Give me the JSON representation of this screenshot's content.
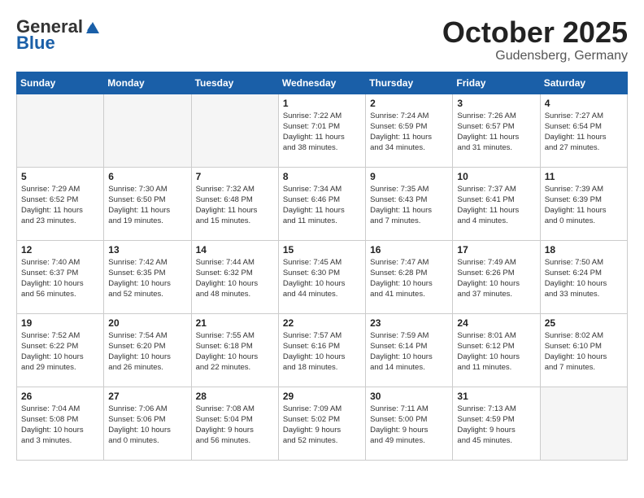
{
  "logo": {
    "general": "General",
    "blue": "Blue"
  },
  "title": "October 2025",
  "location": "Gudensberg, Germany",
  "days_of_week": [
    "Sunday",
    "Monday",
    "Tuesday",
    "Wednesday",
    "Thursday",
    "Friday",
    "Saturday"
  ],
  "weeks": [
    [
      {
        "num": "",
        "info": ""
      },
      {
        "num": "",
        "info": ""
      },
      {
        "num": "",
        "info": ""
      },
      {
        "num": "1",
        "info": "Sunrise: 7:22 AM\nSunset: 7:01 PM\nDaylight: 11 hours\nand 38 minutes."
      },
      {
        "num": "2",
        "info": "Sunrise: 7:24 AM\nSunset: 6:59 PM\nDaylight: 11 hours\nand 34 minutes."
      },
      {
        "num": "3",
        "info": "Sunrise: 7:26 AM\nSunset: 6:57 PM\nDaylight: 11 hours\nand 31 minutes."
      },
      {
        "num": "4",
        "info": "Sunrise: 7:27 AM\nSunset: 6:54 PM\nDaylight: 11 hours\nand 27 minutes."
      }
    ],
    [
      {
        "num": "5",
        "info": "Sunrise: 7:29 AM\nSunset: 6:52 PM\nDaylight: 11 hours\nand 23 minutes."
      },
      {
        "num": "6",
        "info": "Sunrise: 7:30 AM\nSunset: 6:50 PM\nDaylight: 11 hours\nand 19 minutes."
      },
      {
        "num": "7",
        "info": "Sunrise: 7:32 AM\nSunset: 6:48 PM\nDaylight: 11 hours\nand 15 minutes."
      },
      {
        "num": "8",
        "info": "Sunrise: 7:34 AM\nSunset: 6:46 PM\nDaylight: 11 hours\nand 11 minutes."
      },
      {
        "num": "9",
        "info": "Sunrise: 7:35 AM\nSunset: 6:43 PM\nDaylight: 11 hours\nand 7 minutes."
      },
      {
        "num": "10",
        "info": "Sunrise: 7:37 AM\nSunset: 6:41 PM\nDaylight: 11 hours\nand 4 minutes."
      },
      {
        "num": "11",
        "info": "Sunrise: 7:39 AM\nSunset: 6:39 PM\nDaylight: 11 hours\nand 0 minutes."
      }
    ],
    [
      {
        "num": "12",
        "info": "Sunrise: 7:40 AM\nSunset: 6:37 PM\nDaylight: 10 hours\nand 56 minutes."
      },
      {
        "num": "13",
        "info": "Sunrise: 7:42 AM\nSunset: 6:35 PM\nDaylight: 10 hours\nand 52 minutes."
      },
      {
        "num": "14",
        "info": "Sunrise: 7:44 AM\nSunset: 6:32 PM\nDaylight: 10 hours\nand 48 minutes."
      },
      {
        "num": "15",
        "info": "Sunrise: 7:45 AM\nSunset: 6:30 PM\nDaylight: 10 hours\nand 44 minutes."
      },
      {
        "num": "16",
        "info": "Sunrise: 7:47 AM\nSunset: 6:28 PM\nDaylight: 10 hours\nand 41 minutes."
      },
      {
        "num": "17",
        "info": "Sunrise: 7:49 AM\nSunset: 6:26 PM\nDaylight: 10 hours\nand 37 minutes."
      },
      {
        "num": "18",
        "info": "Sunrise: 7:50 AM\nSunset: 6:24 PM\nDaylight: 10 hours\nand 33 minutes."
      }
    ],
    [
      {
        "num": "19",
        "info": "Sunrise: 7:52 AM\nSunset: 6:22 PM\nDaylight: 10 hours\nand 29 minutes."
      },
      {
        "num": "20",
        "info": "Sunrise: 7:54 AM\nSunset: 6:20 PM\nDaylight: 10 hours\nand 26 minutes."
      },
      {
        "num": "21",
        "info": "Sunrise: 7:55 AM\nSunset: 6:18 PM\nDaylight: 10 hours\nand 22 minutes."
      },
      {
        "num": "22",
        "info": "Sunrise: 7:57 AM\nSunset: 6:16 PM\nDaylight: 10 hours\nand 18 minutes."
      },
      {
        "num": "23",
        "info": "Sunrise: 7:59 AM\nSunset: 6:14 PM\nDaylight: 10 hours\nand 14 minutes."
      },
      {
        "num": "24",
        "info": "Sunrise: 8:01 AM\nSunset: 6:12 PM\nDaylight: 10 hours\nand 11 minutes."
      },
      {
        "num": "25",
        "info": "Sunrise: 8:02 AM\nSunset: 6:10 PM\nDaylight: 10 hours\nand 7 minutes."
      }
    ],
    [
      {
        "num": "26",
        "info": "Sunrise: 7:04 AM\nSunset: 5:08 PM\nDaylight: 10 hours\nand 3 minutes."
      },
      {
        "num": "27",
        "info": "Sunrise: 7:06 AM\nSunset: 5:06 PM\nDaylight: 10 hours\nand 0 minutes."
      },
      {
        "num": "28",
        "info": "Sunrise: 7:08 AM\nSunset: 5:04 PM\nDaylight: 9 hours\nand 56 minutes."
      },
      {
        "num": "29",
        "info": "Sunrise: 7:09 AM\nSunset: 5:02 PM\nDaylight: 9 hours\nand 52 minutes."
      },
      {
        "num": "30",
        "info": "Sunrise: 7:11 AM\nSunset: 5:00 PM\nDaylight: 9 hours\nand 49 minutes."
      },
      {
        "num": "31",
        "info": "Sunrise: 7:13 AM\nSunset: 4:59 PM\nDaylight: 9 hours\nand 45 minutes."
      },
      {
        "num": "",
        "info": ""
      }
    ]
  ]
}
